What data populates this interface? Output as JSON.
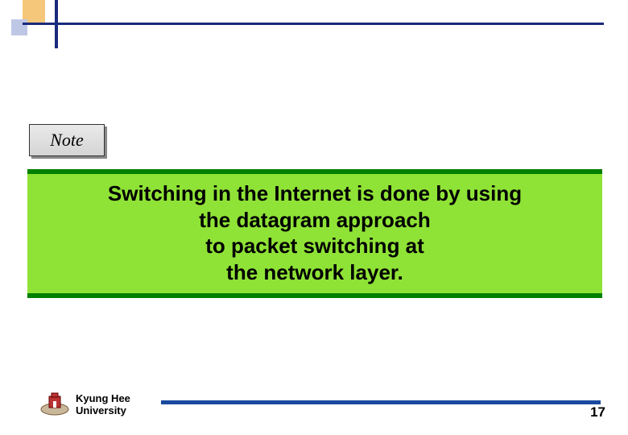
{
  "note_label": "Note",
  "content": {
    "line1": "Switching in the Internet is done by using",
    "line2": "the datagram approach",
    "line3": "to packet switching at",
    "line4": "the network layer."
  },
  "footer": {
    "university_line1": "Kyung Hee",
    "university_line2": "University",
    "page_number": "17"
  }
}
